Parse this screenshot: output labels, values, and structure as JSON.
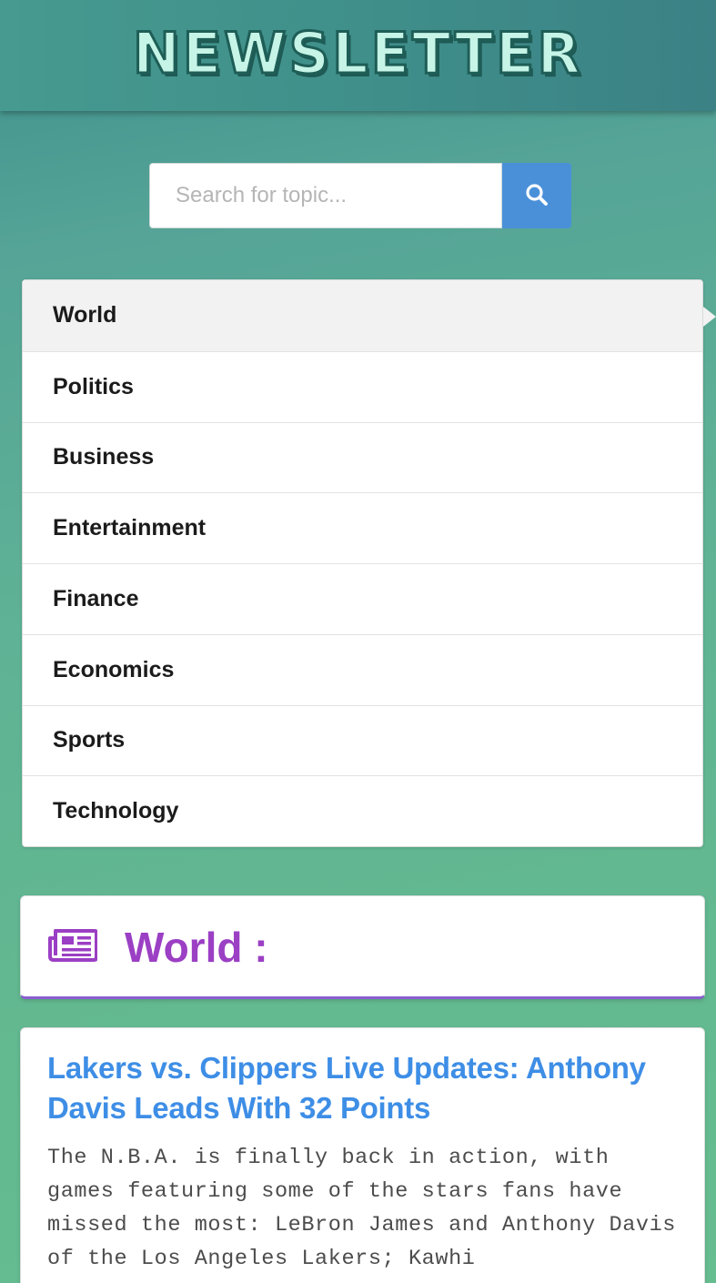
{
  "header": {
    "logo_text": "NEWSLETTER"
  },
  "search": {
    "placeholder": "Search for topic...",
    "value": "",
    "button_icon": "search-icon"
  },
  "menu": {
    "active_index": 0,
    "items": [
      {
        "label": "World"
      },
      {
        "label": "Politics"
      },
      {
        "label": "Business"
      },
      {
        "label": "Entertainment"
      },
      {
        "label": "Finance"
      },
      {
        "label": "Economics"
      },
      {
        "label": "Sports"
      },
      {
        "label": "Technology"
      }
    ]
  },
  "section": {
    "icon": "newspaper-icon",
    "title": "World :"
  },
  "articles": [
    {
      "title": "Lakers vs. Clippers Live Updates: Anthony Davis Leads With 32 Points",
      "description": "The N.B.A. is finally back in action, with games featuring some of the stars fans have missed the most: LeBron James and Anthony Davis of the Los Angeles Lakers; Kawhi"
    }
  ],
  "colors": {
    "accent_blue": "#4a90d9",
    "link_blue": "#3e8ee6",
    "section_purple": "#9b3fc4",
    "background_green": "#63b990"
  }
}
